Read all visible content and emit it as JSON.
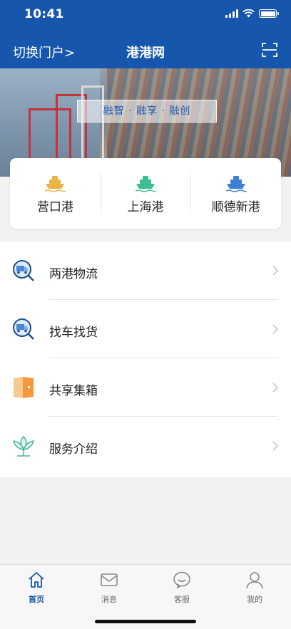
{
  "status_bar": {
    "time": "10:41"
  },
  "nav": {
    "switch_label": "切换门户>",
    "title": "港港网"
  },
  "banner": {
    "slogan": "融智 · 融享 · 融创"
  },
  "ports": [
    {
      "label": "营口港",
      "color": "#e9b443"
    },
    {
      "label": "上海港",
      "color": "#3cbf93"
    },
    {
      "label": "顺德新港",
      "color": "#3f7fd6"
    }
  ],
  "menu": [
    {
      "label": "两港物流",
      "icon": "truck-search-icon"
    },
    {
      "label": "找车找货",
      "icon": "truck-search-icon"
    },
    {
      "label": "共享集箱",
      "icon": "container-icon"
    },
    {
      "label": "服务介绍",
      "icon": "lotus-icon"
    }
  ],
  "tabs": [
    {
      "label": "首页",
      "icon": "home-icon",
      "active": true
    },
    {
      "label": "消息",
      "icon": "mail-icon",
      "active": false
    },
    {
      "label": "客服",
      "icon": "chat-icon",
      "active": false
    },
    {
      "label": "我的",
      "icon": "user-icon",
      "active": false
    }
  ],
  "colors": {
    "brand": "#1657ad",
    "active_tab": "#1657ad"
  }
}
